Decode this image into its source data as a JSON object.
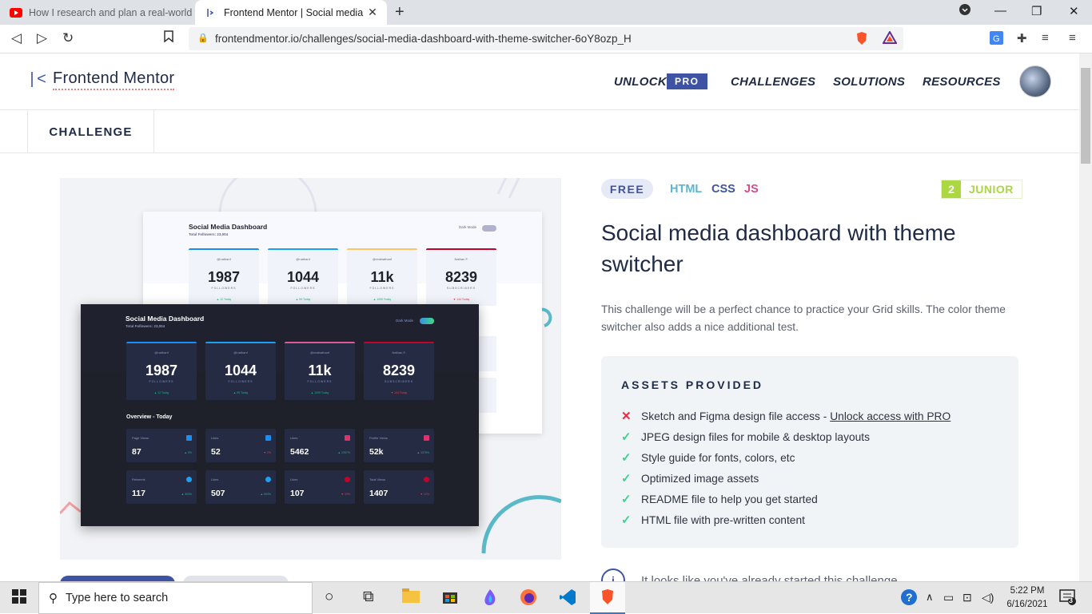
{
  "browser": {
    "tabs": [
      {
        "title": "How I research and plan a real-world w",
        "favicon": "youtube-icon"
      },
      {
        "title": "Frontend Mentor | Social media d",
        "favicon": "frontend-mentor-icon"
      }
    ],
    "url": "frontendmentor.io/challenges/social-media-dashboard-with-theme-switcher-6oY8ozp_H"
  },
  "site": {
    "logo_text": "Frontend Mentor",
    "logo_mark": "|<",
    "nav": {
      "unlock": "UNLOCK",
      "pro": "PRO",
      "challenges": "CHALLENGES",
      "solutions": "SOLUTIONS",
      "resources": "RESOURCES"
    },
    "subnav": {
      "challenge": "CHALLENGE"
    }
  },
  "preview": {
    "light": {
      "title": "Social Media Dashboard",
      "total": "Total Followers: 23,004",
      "mode": "Dark Mode",
      "cards": [
        {
          "handle": "@nathanf",
          "num": "1987",
          "label": "FOLLOWERS",
          "today": "▲ 12 Today",
          "color": "#198ff5"
        },
        {
          "handle": "@nathanf",
          "num": "1044",
          "label": "FOLLOWERS",
          "today": "▲ 99 Today",
          "color": "#1ca0f2"
        },
        {
          "handle": "@realnathanf",
          "num": "11k",
          "label": "FOLLOWERS",
          "today": "▲ 1099 Today",
          "color": "#fdc468"
        },
        {
          "handle": "Nathan F.",
          "num": "8239",
          "label": "SUBSCRIBERS",
          "today": "▼ 144 Today",
          "color": "#c4032a"
        }
      ]
    },
    "dark": {
      "title": "Social Media Dashboard",
      "total": "Total Followers: 23,004",
      "mode": "Dark Mode",
      "overview": "Overview - Today",
      "cards": [
        {
          "handle": "@nathanf",
          "num": "1987",
          "label": "FOLLOWERS",
          "today": "▲ 12 Today",
          "color": "#198ff5"
        },
        {
          "handle": "@nathanf",
          "num": "1044",
          "label": "FOLLOWERS",
          "today": "▲ 99 Today",
          "color": "#1ca0f2"
        },
        {
          "handle": "@realnathanf",
          "num": "11k",
          "label": "FOLLOWERS",
          "today": "▲ 1099 Today",
          "color": "#fdc468"
        },
        {
          "handle": "Nathan F.",
          "num": "8239",
          "label": "SUBSCRIBERS",
          "today": "▼ 144 Today",
          "color": "#c4032a"
        }
      ],
      "stats": [
        {
          "label": "Page Views",
          "value": "87",
          "pct": "▲ 3%",
          "color": "#198ff5"
        },
        {
          "label": "Likes",
          "value": "52",
          "pct": "▼ 2%",
          "color": "#198ff5"
        },
        {
          "label": "Likes",
          "value": "5462",
          "pct": "▲ 2257%",
          "color": "#e1306c"
        },
        {
          "label": "Profile Views",
          "value": "52k",
          "pct": "▲ 1375%",
          "color": "#e1306c"
        },
        {
          "label": "Retweets",
          "value": "117",
          "pct": "▲ 303%",
          "color": "#1ca0f2"
        },
        {
          "label": "Likes",
          "value": "507",
          "pct": "▲ 553%",
          "color": "#1ca0f2"
        },
        {
          "label": "Likes",
          "value": "107",
          "pct": "▼ 19%",
          "color": "#c4032a"
        },
        {
          "label": "Total Views",
          "value": "1407",
          "pct": "▼ 12%",
          "color": "#c4032a"
        }
      ]
    }
  },
  "challenge": {
    "price": "FREE",
    "langs": [
      {
        "name": "HTML",
        "color": "#5bb7d0"
      },
      {
        "name": "CSS",
        "color": "#3e54a3"
      },
      {
        "name": "JS",
        "color": "#d34d8a"
      }
    ],
    "level_num": "2",
    "level_name": "JUNIOR",
    "title": "Social media dashboard with theme switcher",
    "description": "This challenge will be a perfect chance to practice your Grid skills. The color theme switcher also adds a nice additional test.",
    "assets_heading": "ASSETS PROVIDED",
    "assets": [
      {
        "mark": "✕",
        "ok": false,
        "text": "Sketch and Figma design file access - ",
        "link": "Unlock access with PRO"
      },
      {
        "mark": "✓",
        "ok": true,
        "text": "JPEG design files for mobile & desktop layouts",
        "link": ""
      },
      {
        "mark": "✓",
        "ok": true,
        "text": "Style guide for fonts, colors, etc",
        "link": ""
      },
      {
        "mark": "✓",
        "ok": true,
        "text": "Optimized image assets",
        "link": ""
      },
      {
        "mark": "✓",
        "ok": true,
        "text": "README file to help you get started",
        "link": ""
      },
      {
        "mark": "✓",
        "ok": true,
        "text": "HTML file with pre-written content",
        "link": ""
      }
    ],
    "started_note": "It looks like you've already started this challenge"
  },
  "taskbar": {
    "search_placeholder": "Type here to search",
    "time": "5:22 PM",
    "date": "6/16/2021",
    "notifications": "3"
  },
  "colors": {
    "accent": "#3e54a3",
    "junior": "#aad742",
    "check": "#3dd28d",
    "cross": "#e0314b"
  }
}
